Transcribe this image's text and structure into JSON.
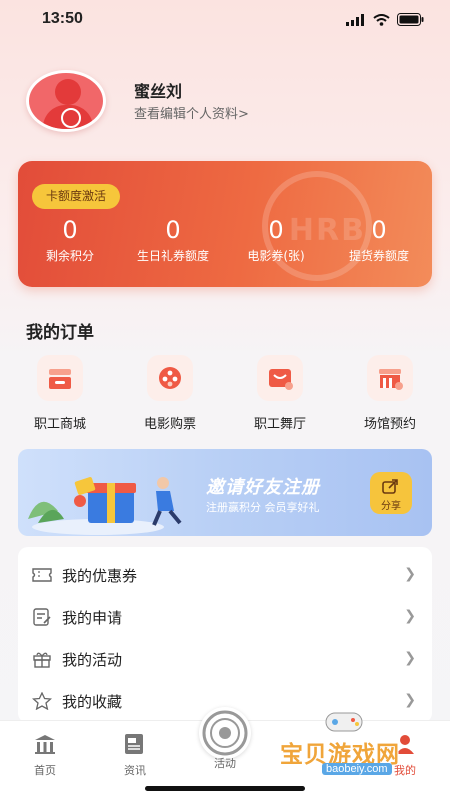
{
  "status": {
    "time": "13:50"
  },
  "profile": {
    "name": "蜜丝刘",
    "edit_link": "查看编辑个人资料>"
  },
  "card": {
    "badge": "卡额度激活",
    "watermark": "HRB",
    "stats": [
      {
        "value": "0",
        "label": "剩余积分"
      },
      {
        "value": "0",
        "label": "生日礼券额度"
      },
      {
        "value": "0",
        "label": "电影券(张)"
      },
      {
        "value": "0",
        "label": "提货券额度"
      }
    ]
  },
  "orders": {
    "title": "我的订单",
    "items": [
      {
        "label": "职工商城",
        "icon": "shop-icon"
      },
      {
        "label": "电影购票",
        "icon": "film-reel-icon"
      },
      {
        "label": "职工舞厅",
        "icon": "dance-hall-icon"
      },
      {
        "label": "场馆预约",
        "icon": "venue-icon"
      }
    ]
  },
  "banner": {
    "title": "邀请好友注册",
    "subtitle": "注册赢积分 会员享好礼",
    "button": "分享"
  },
  "menu": [
    {
      "label": "我的优惠券",
      "icon": "coupon-icon"
    },
    {
      "label": "我的申请",
      "icon": "application-icon"
    },
    {
      "label": "我的活动",
      "icon": "gift-icon"
    },
    {
      "label": "我的收藏",
      "icon": "star-icon"
    }
  ],
  "tabbar": [
    {
      "label": "首页",
      "icon": "home-icon"
    },
    {
      "label": "资讯",
      "icon": "news-icon"
    },
    {
      "label": "活动",
      "icon": "activity-icon"
    },
    {
      "label": "我的",
      "icon": "profile-icon"
    }
  ],
  "watermark": {
    "text": "宝贝游戏网",
    "url": "baobeiy.com"
  },
  "colors": {
    "accent": "#e24c39",
    "badge": "#f6c63b",
    "banner": "#b8cff5"
  }
}
